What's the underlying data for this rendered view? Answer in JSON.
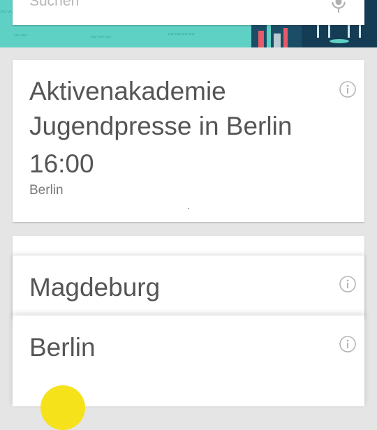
{
  "search": {
    "placeholder": "Suchen",
    "mic_icon": "microphone-icon"
  },
  "cards": {
    "event": {
      "title": "Aktivenakademie Jugendpresse in Berlin",
      "time": "16:00",
      "location": "Berlin",
      "info_icon": "info-icon"
    },
    "weather_magdeburg": {
      "city": "Magdeburg",
      "info_icon": "info-icon"
    },
    "weather_berlin": {
      "city": "Berlin",
      "info_icon": "info-icon",
      "weather_icon": "sun-icon"
    }
  },
  "colors": {
    "background": "#e5e5e5",
    "header_teal": "#5fd1c4",
    "header_city": "#1c4d66",
    "text_primary": "#555555",
    "text_secondary": "#7a7a7a",
    "sun": "#f5e21b"
  }
}
